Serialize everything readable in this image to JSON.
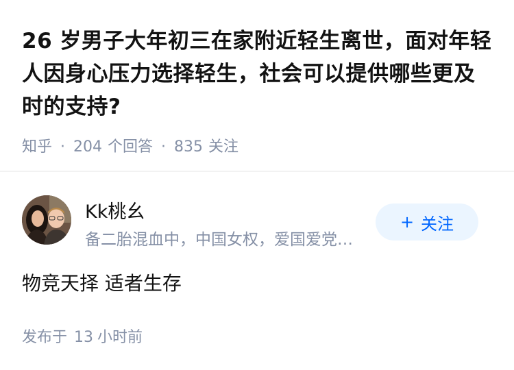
{
  "question": {
    "title": "26 岁男子大年初三在家附近轻生离世，面对年轻人因身心压力选择轻生，社会可以提供哪些更及时的支持?",
    "source": "知乎",
    "separator": "·",
    "answer_count": "204",
    "answer_count_label": "个回答",
    "follower_count": "835",
    "follower_count_label": "关注"
  },
  "answer": {
    "author": {
      "name": "Kk桃幺",
      "bio": "备二胎混血中，中国女权，爱国爱党，反对台独",
      "avatar_icon": "avatar-photo-icon"
    },
    "follow_button": {
      "plus": "+",
      "label": "关注"
    },
    "content": "物竞天择 适者生存",
    "time_prefix": "发布于",
    "time_value": "13",
    "time_suffix": "小时前"
  },
  "colors": {
    "text": "#121212",
    "secondary": "#8590a6",
    "accent": "#0066ff",
    "button_bg": "#ebf5ff"
  }
}
